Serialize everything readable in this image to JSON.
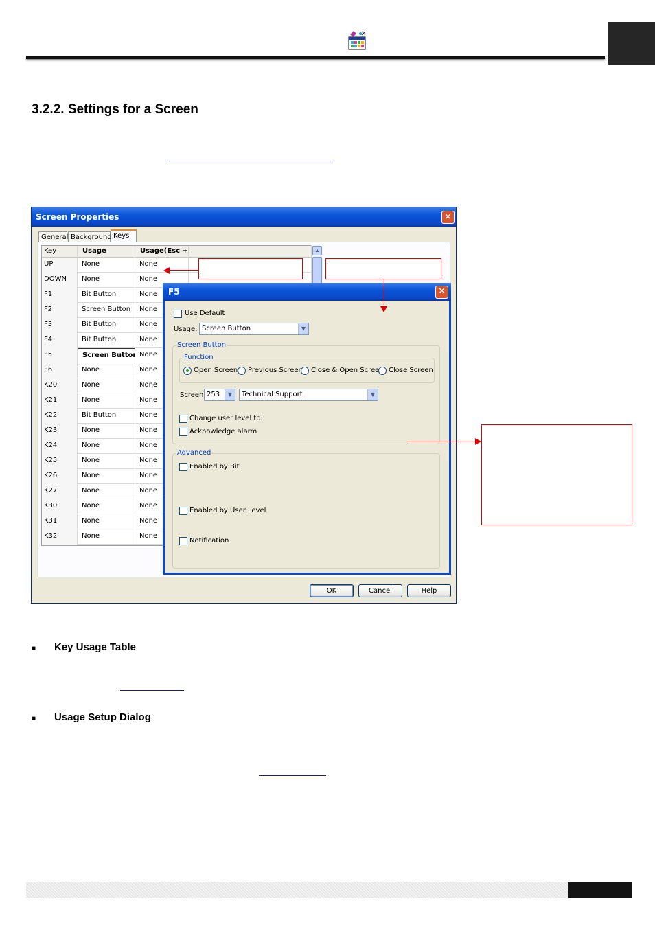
{
  "section": {
    "title": "3.2.2. Settings for a Screen"
  },
  "screen_properties": {
    "title": "Screen Properties",
    "tabs": [
      "General",
      "Background",
      "Keys"
    ],
    "active_tab": "Keys",
    "table": {
      "headers": [
        "Key",
        "Usage",
        "Usage(Esc +)"
      ],
      "rows": [
        [
          "UP",
          "None",
          "None"
        ],
        [
          "DOWN",
          "None",
          "None"
        ],
        [
          "F1",
          "Bit Button",
          "None"
        ],
        [
          "F2",
          "Screen Button",
          "None"
        ],
        [
          "F3",
          "Bit Button",
          "None"
        ],
        [
          "F4",
          "Bit Button",
          "None"
        ],
        [
          "F5",
          "Screen Button",
          "None"
        ],
        [
          "F6",
          "None",
          "None"
        ],
        [
          "K20",
          "None",
          "None"
        ],
        [
          "K21",
          "None",
          "None"
        ],
        [
          "K22",
          "Bit Button",
          "None"
        ],
        [
          "K23",
          "None",
          "None"
        ],
        [
          "K24",
          "None",
          "None"
        ],
        [
          "K25",
          "None",
          "None"
        ],
        [
          "K26",
          "None",
          "None"
        ],
        [
          "K27",
          "None",
          "None"
        ],
        [
          "K30",
          "None",
          "None"
        ],
        [
          "K31",
          "None",
          "None"
        ],
        [
          "K32",
          "None",
          "None"
        ]
      ],
      "selected_row": 6
    },
    "buttons": {
      "ok": "OK",
      "cancel": "Cancel",
      "help": "Help"
    }
  },
  "f5_dialog": {
    "title": "F5",
    "use_default_label": "Use Default",
    "usage_label": "Usage:",
    "usage_value": "Screen Button",
    "screen_button_group": "Screen Button",
    "function_group": "Function",
    "functions": [
      "Open Screen",
      "Previous Screen",
      "Close & Open Screen",
      "Close Screen"
    ],
    "selected_function": "Open Screen",
    "screen_label": "Screen:",
    "screen_number": "253",
    "screen_name": "Technical Support",
    "change_user_level_label": "Change user level to:",
    "acknowledge_alarm_label": "Acknowledge alarm",
    "advanced_group": "Advanced",
    "enabled_by_bit_label": "Enabled by Bit",
    "enabled_by_user_level_label": "Enabled by User Level",
    "notification_label": "Notification"
  },
  "bullets": [
    {
      "text": "Key Usage Table"
    },
    {
      "text": "Usage Setup Dialog"
    }
  ],
  "icons": {
    "header": "app-logo-icon",
    "bullet": "square-bullet-icon",
    "close": "close-x-icon",
    "dropdown": "chevron-down-icon"
  },
  "colors": {
    "annotation": "#e00000",
    "xp_title": "#0a54d8",
    "dialog_face": "#ece9d8",
    "group_title": "#0046d5"
  }
}
